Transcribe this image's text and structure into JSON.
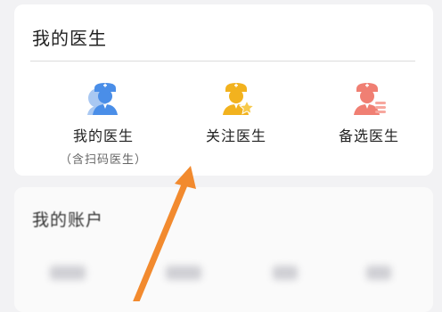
{
  "doctors_card": {
    "title": "我的医生",
    "items": [
      {
        "label": "我的医生",
        "sublabel": "（含扫码医生）",
        "icon": "doctor-icon"
      },
      {
        "label": "关注医生",
        "icon": "doctor-star-icon"
      },
      {
        "label": "备选医生",
        "icon": "doctor-list-icon"
      }
    ]
  },
  "account_card": {
    "title": "我的账户"
  },
  "colors": {
    "doctor_blue": "#4a8ee8",
    "doctor_gold": "#f2b21e",
    "doctor_salmon": "#f07f73",
    "annotation_arrow": "#f28a2e"
  }
}
